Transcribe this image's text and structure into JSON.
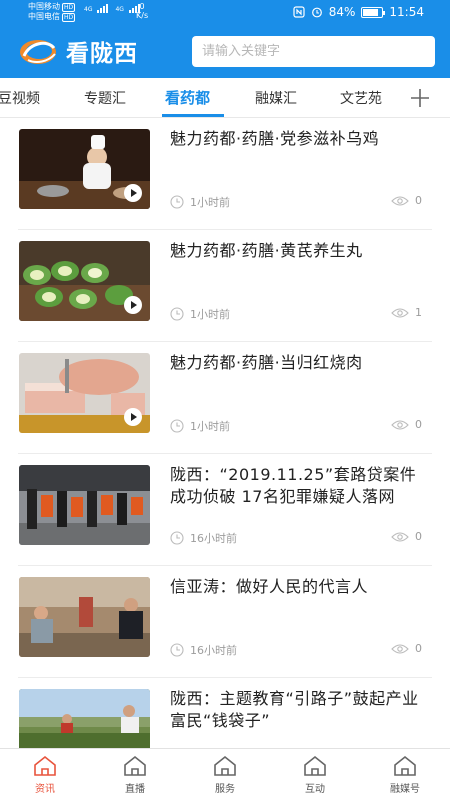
{
  "status_bar": {
    "carrier_1": "中国移动",
    "carrier_2": "中国电信",
    "hd_badge": "HD",
    "network_1": "4G",
    "network_2": "4G",
    "net_speed_value": "0",
    "net_speed_unit": "K/s",
    "battery": "84%",
    "battery_level": 0.84,
    "time": "11:54"
  },
  "header": {
    "app_name": "看陇西",
    "search_placeholder": "请输入关键字"
  },
  "tabs": {
    "items": [
      {
        "label": "豆视频"
      },
      {
        "label": "专题汇"
      },
      {
        "label": "看药都",
        "active": true
      },
      {
        "label": "融媒汇"
      },
      {
        "label": "文艺苑"
      }
    ]
  },
  "news": [
    {
      "title": "魅力药都·药膳·党参滋补乌鸡",
      "time": "1小时前",
      "views": "0",
      "video": true
    },
    {
      "title": "魅力药都·药膳·黄芪养生丸",
      "time": "1小时前",
      "views": "1",
      "video": true
    },
    {
      "title": "魅力药都·药膳·当归红烧肉",
      "time": "1小时前",
      "views": "0",
      "video": true
    },
    {
      "title": "陇西：“2019.11.25”套路贷案件成功侦破 17名犯罪嫌疑人落网",
      "time": "16小时前",
      "views": "0",
      "video": false
    },
    {
      "title": "信亚涛：做好人民的代言人",
      "time": "16小时前",
      "views": "0",
      "video": false
    },
    {
      "title": "陇西：主题教育“引路子”鼓起产业富民“钱袋子”",
      "time": "",
      "views": "",
      "video": false
    }
  ],
  "bottom_nav": {
    "items": [
      {
        "label": "资讯",
        "active": true
      },
      {
        "label": "直播"
      },
      {
        "label": "服务"
      },
      {
        "label": "互动"
      },
      {
        "label": "融媒号"
      }
    ]
  },
  "colors": {
    "brand_blue": "#1a8ee8",
    "active_nav": "#e8543d"
  }
}
